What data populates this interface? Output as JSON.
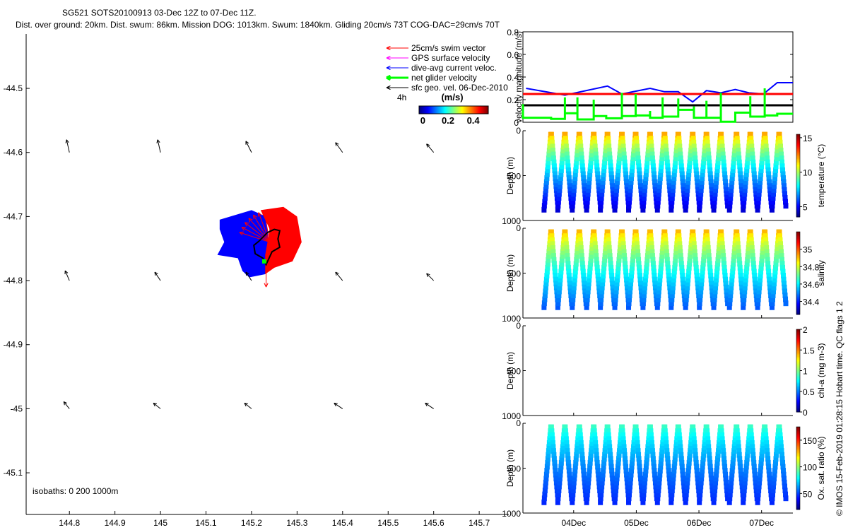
{
  "title": {
    "line1": "SG521 SOTS20100913 03-Dec 12Z to 07-Dec 11Z.",
    "line2": "Dist. over ground: 20km. Dist. swum: 86km. Mission DOG: 1013km. Swum: 1840km. Gliding 20cm/s 73T COG-DAC=29cm/s 70T"
  },
  "credit": "© IMOS 15-Feb-2019 01:28:15 Hobart time. QC flags 1  2",
  "chart_data": [
    {
      "type": "map-vector",
      "xlim": [
        144.705,
        145.765
      ],
      "ylim": [
        -45.165,
        -44.415
      ],
      "xticks": [
        "144.8",
        "144.9",
        "145",
        "145.1",
        "145.2",
        "145.3",
        "145.4",
        "145.5",
        "145.6",
        "145.7"
      ],
      "yticks": [
        "-44.5",
        "-44.6",
        "-44.7",
        "-44.8",
        "-44.9",
        "-45",
        "-45.1"
      ],
      "isobaths_label": "isobaths: 0   200  1000m",
      "legend": {
        "placement": "top-right",
        "items": [
          {
            "label": "25cm/s swim vector",
            "color": "#ff0000"
          },
          {
            "label": "GPS surface velocity",
            "color": "#ff00ff"
          },
          {
            "label": "dive-avg current veloc.",
            "color": "#0000ff"
          },
          {
            "label": "net glider velocity",
            "color": "#00ff00"
          },
          {
            "label": "sfc geo. vel. 06-Dec-2010",
            "color": "#000000"
          }
        ],
        "interval": "4h",
        "colorbar_label": "(m/s)",
        "colorbar_ticks": [
          "0",
          "0.2",
          "0.4"
        ],
        "colorbar_range": [
          -0.03,
          0.52
        ]
      },
      "geo_vectors": {
        "lons": [
          144.8,
          145.0,
          145.2,
          145.4,
          145.6
        ],
        "lats": [
          -44.6,
          -44.8,
          -45.0
        ],
        "u": [
          [
            -0.02,
            -0.02,
            -0.04,
            -0.05,
            -0.05
          ],
          [
            -0.03,
            -0.04,
            -0.04,
            -0.05,
            -0.05
          ],
          [
            -0.04,
            -0.05,
            -0.05,
            -0.06,
            -0.06
          ]
        ],
        "v": [
          [
            0.09,
            0.09,
            0.08,
            0.07,
            0.06
          ],
          [
            0.07,
            0.06,
            0.06,
            0.06,
            0.05
          ],
          [
            0.05,
            0.04,
            0.04,
            0.04,
            0.04
          ]
        ]
      },
      "glider_track": [
        [
          145.217,
          -44.738
        ],
        [
          145.235,
          -44.725
        ],
        [
          145.25,
          -44.72
        ],
        [
          145.262,
          -44.722
        ],
        [
          145.258,
          -44.735
        ],
        [
          145.262,
          -44.748
        ],
        [
          145.245,
          -44.755
        ],
        [
          145.232,
          -44.775
        ],
        [
          145.225,
          -44.765
        ],
        [
          145.208,
          -44.758
        ],
        [
          145.205,
          -44.745
        ],
        [
          145.217,
          -44.738
        ]
      ]
    },
    {
      "type": "line",
      "ylabel": "velocity magnitude (m/s)",
      "ylim": [
        0,
        0.8
      ],
      "yticks": [
        "0",
        "0.2",
        "0.4",
        "0.6",
        "0.8"
      ],
      "xlim": [
        3.19,
        7.5
      ],
      "series": [
        {
          "color": "#0000ff",
          "x": [
            3.24,
            3.86,
            4.54,
            4.77,
            5.22,
            5.45,
            5.67,
            5.9,
            6.12,
            6.35,
            6.58,
            6.8,
            7.03,
            7.25,
            7.5
          ],
          "y": [
            0.3,
            0.24,
            0.32,
            0.25,
            0.3,
            0.27,
            0.27,
            0.18,
            0.28,
            0.26,
            0.29,
            0.26,
            0.25,
            0.35,
            0.35
          ]
        },
        {
          "color": "#ff0000",
          "x": [
            3.19,
            7.5
          ],
          "y": [
            0.25,
            0.25
          ]
        },
        {
          "color": "#000000",
          "x": [
            3.19,
            7.5
          ],
          "y": [
            0.15,
            0.15
          ]
        },
        {
          "color": "#00ff00",
          "steps": [
            [
              3.19,
              0.04,
              0.16
            ],
            [
              3.64,
              0.03,
              0
            ],
            [
              3.86,
              0.08,
              0.22
            ],
            [
              4.06,
              0.025,
              0.22
            ],
            [
              4.32,
              0.055,
              0.2
            ],
            [
              4.52,
              0.035,
              0
            ],
            [
              4.77,
              0.055,
              0.26
            ],
            [
              4.99,
              0.06,
              0.25
            ],
            [
              5.22,
              0.04,
              0.1
            ],
            [
              5.42,
              0.05,
              0.22
            ],
            [
              5.67,
              0.11,
              0.21
            ],
            [
              5.92,
              0.04,
              0.14
            ],
            [
              6.12,
              0.04,
              0.19
            ],
            [
              6.35,
              0.005,
              0.26
            ],
            [
              6.58,
              0.085,
              0
            ],
            [
              6.82,
              0.05,
              0.23
            ],
            [
              7.05,
              0.06,
              0.3
            ],
            [
              7.25,
              0.075,
              0
            ]
          ]
        }
      ]
    },
    {
      "type": "scatter-section",
      "xticks": [
        {
          "x": 4,
          "label": "04Dec"
        },
        {
          "x": 5,
          "label": "05Dec"
        },
        {
          "x": 6,
          "label": "06Dec"
        },
        {
          "x": 7,
          "label": "07Dec"
        }
      ],
      "xlim": [
        3.19,
        7.5
      ],
      "ylabel": "Depth (m)",
      "ylim": [
        1000,
        0
      ],
      "yticks": [
        "0",
        "500",
        "1000"
      ],
      "dive_surface_days": [
        3.64,
        3.86,
        4.09,
        4.32,
        4.54,
        4.77,
        4.99,
        5.22,
        5.45,
        5.67,
        5.9,
        6.12,
        6.35,
        6.6,
        6.82,
        7.05,
        7.28
      ],
      "max_depth": 880,
      "panels": [
        {
          "variable": "temperature (°C)",
          "clim": [
            3.5,
            15.5
          ],
          "cticks": [
            "5",
            "10",
            "15"
          ],
          "cvals": [
            5,
            10,
            15
          ],
          "surface": 13.5,
          "deep": 4.5
        },
        {
          "variable": "salinity",
          "clim": [
            34.25,
            35.2
          ],
          "cticks": [
            "34.4",
            "34.6",
            "34.8",
            "35"
          ],
          "cvals": [
            34.4,
            34.6,
            34.8,
            35
          ],
          "surface": 35.0,
          "deep": 34.45
        },
        {
          "variable": "chl-a (mg m-3)",
          "clim": [
            0,
            2
          ],
          "cticks": [
            "0",
            "0.5",
            "1",
            "1.5",
            "2"
          ],
          "cvals": [
            0,
            0.5,
            1,
            1.5,
            2
          ],
          "surface": null,
          "deep": null
        },
        {
          "variable": "Ox. sat. ratio (%)",
          "clim": [
            20,
            175
          ],
          "cticks": [
            "50",
            "100",
            "150"
          ],
          "cvals": [
            50,
            100,
            150
          ],
          "surface": 95,
          "deep": 45
        }
      ]
    }
  ]
}
